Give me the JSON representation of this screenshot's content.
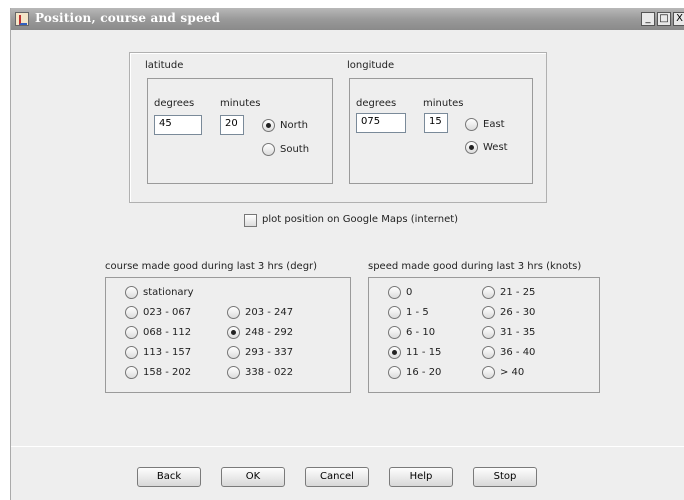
{
  "window": {
    "title": "Position, course and speed",
    "controls": {
      "minimize": "_",
      "maximize": "□",
      "close": "X"
    }
  },
  "latitude": {
    "title": "latitude",
    "degrees_label": "degrees",
    "minutes_label": "minutes",
    "degrees_value": "45",
    "minutes_value": "20",
    "options": [
      {
        "label": "North",
        "selected": true
      },
      {
        "label": "South",
        "selected": false
      }
    ]
  },
  "longitude": {
    "title": "longitude",
    "degrees_label": "degrees",
    "minutes_label": "minutes",
    "degrees_value": "075",
    "minutes_value": "15",
    "options": [
      {
        "label": "East",
        "selected": false
      },
      {
        "label": "West",
        "selected": true
      }
    ]
  },
  "plot_checkbox": {
    "label": "plot position on Google Maps (internet)",
    "checked": false
  },
  "course": {
    "title": "course made good during last 3 hrs (degr)",
    "options": [
      {
        "label": "stationary",
        "selected": false
      },
      {
        "label": "023 - 067",
        "selected": false
      },
      {
        "label": "068 - 112",
        "selected": false
      },
      {
        "label": "113 - 157",
        "selected": false
      },
      {
        "label": "158 - 202",
        "selected": false
      },
      {
        "label": "203 - 247",
        "selected": false
      },
      {
        "label": "248 - 292",
        "selected": true
      },
      {
        "label": "293 - 337",
        "selected": false
      },
      {
        "label": "338 - 022",
        "selected": false
      }
    ]
  },
  "speed": {
    "title": "speed made good during last 3 hrs (knots)",
    "options": [
      {
        "label": "0",
        "selected": false
      },
      {
        "label": "1 - 5",
        "selected": false
      },
      {
        "label": "6 - 10",
        "selected": false
      },
      {
        "label": "11 - 15",
        "selected": true
      },
      {
        "label": "16 - 20",
        "selected": false
      },
      {
        "label": "21 - 25",
        "selected": false
      },
      {
        "label": "26 - 30",
        "selected": false
      },
      {
        "label": "31 - 35",
        "selected": false
      },
      {
        "label": "36 - 40",
        "selected": false
      },
      {
        "label": "> 40",
        "selected": false
      }
    ]
  },
  "buttons": {
    "back": "Back",
    "ok": "OK",
    "cancel": "Cancel",
    "help": "Help",
    "stop": "Stop"
  }
}
